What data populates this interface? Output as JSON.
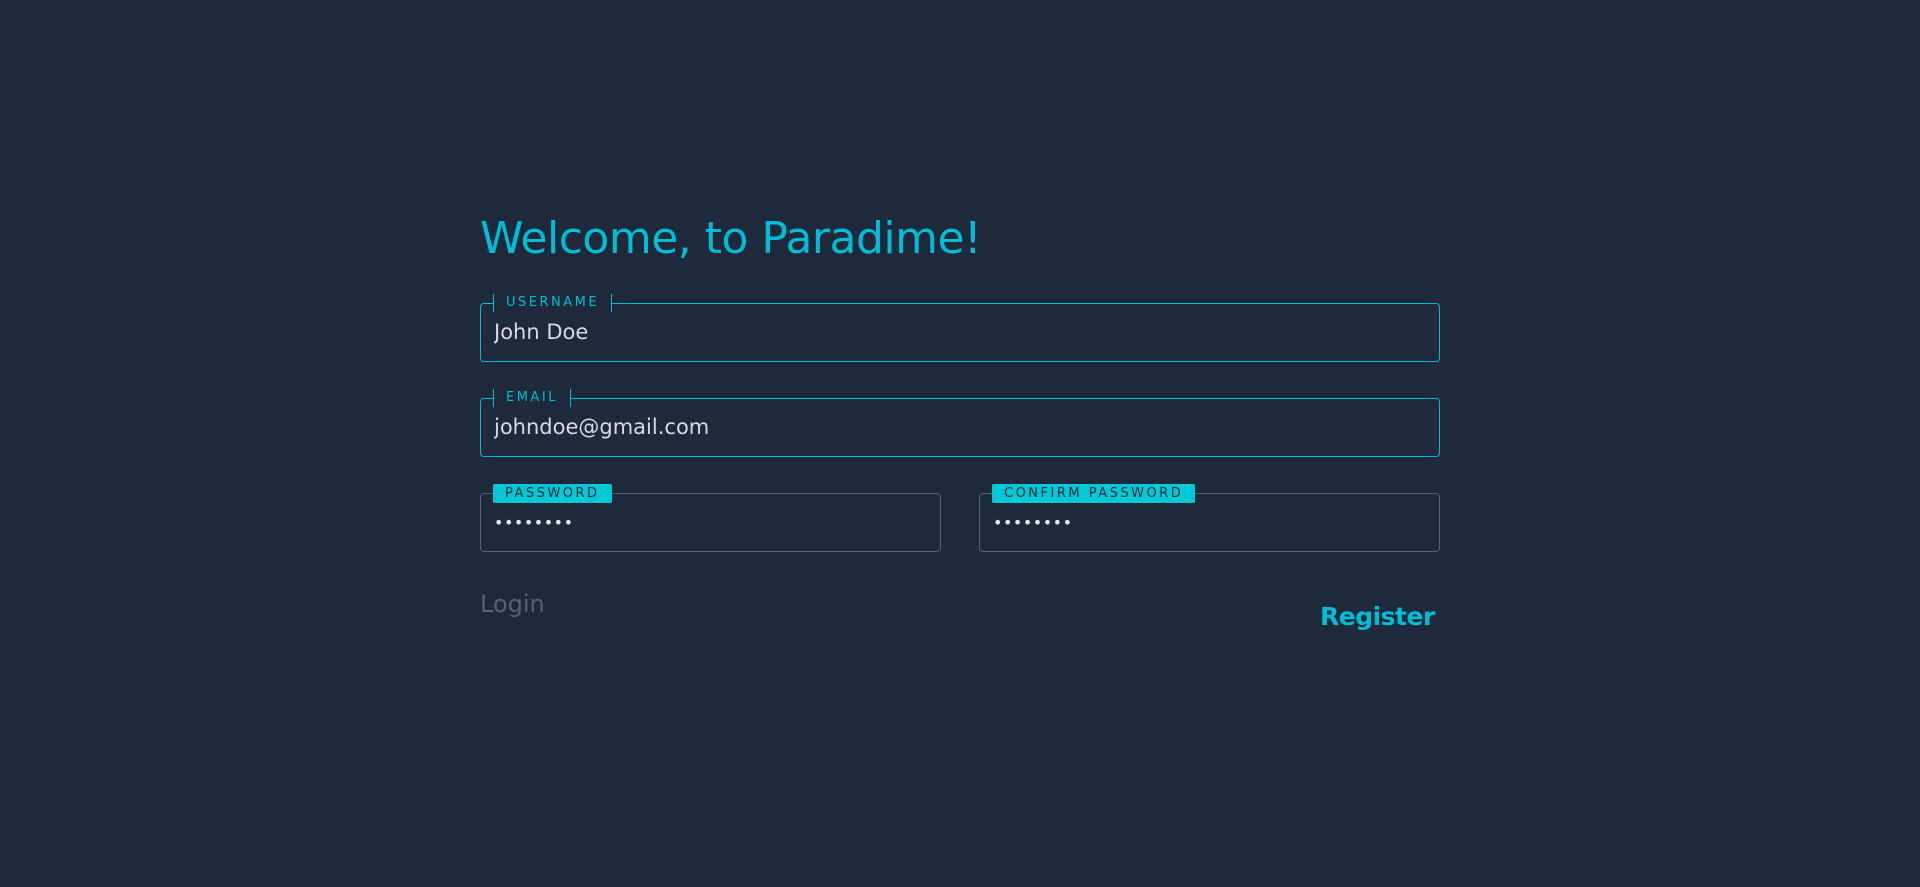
{
  "form": {
    "title": "Welcome, to Paradime!",
    "username": {
      "label": "USERNAME",
      "value": "John Doe"
    },
    "email": {
      "label": "EMAIL",
      "value": "johndoe@gmail.com"
    },
    "password": {
      "label": "PASSWORD",
      "value": "••••••••"
    },
    "confirm_password": {
      "label": "CONFIRM PASSWORD",
      "value": "••••••••"
    },
    "login_label": "Login",
    "register_label": "Register"
  },
  "colors": {
    "background": "#1e2a3c",
    "accent": "#00bcd4",
    "muted": "#566274",
    "text": "#d6dbe3"
  }
}
